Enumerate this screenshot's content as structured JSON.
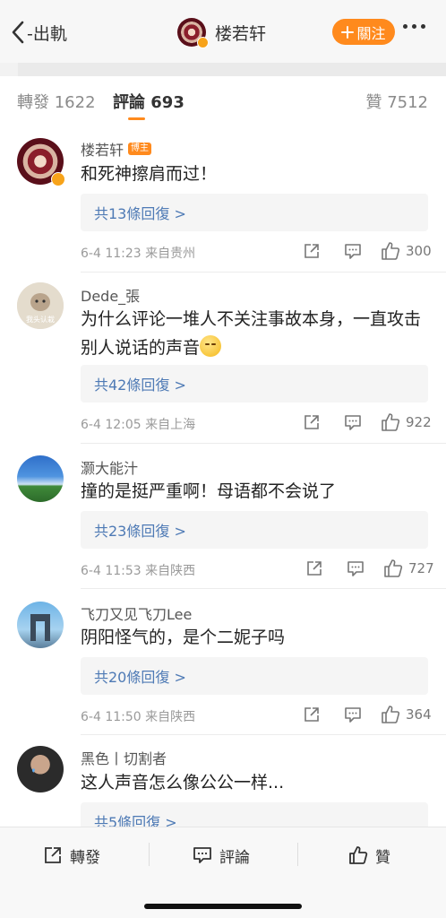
{
  "nav": {
    "back_label": "-出軌",
    "author_name": "楼若轩",
    "follow_label": "關注"
  },
  "tabs": {
    "repost": "轉發 1622",
    "comments": "評論 693",
    "likes": "贊 7512"
  },
  "comments": [
    {
      "author": "楼若轩",
      "author_tag": "博主",
      "text": "和死神擦肩而过！",
      "replies": "共13條回復 >",
      "meta": "6-4 11:23  来自贵州",
      "likes": "300"
    },
    {
      "author": "Dede_張",
      "avatar_text": "我头认栽",
      "text": "为什么评论一堆人不关注事故本身，一直攻击别人说话的声音",
      "emoji": "sleepy-emoji",
      "replies": "共42條回復 >",
      "meta": "6-4 12:05  来自上海",
      "likes": "922"
    },
    {
      "author": "灏大能汁",
      "text": "撞的是挺严重啊！母语都不会说了",
      "replies": "共23條回復 >",
      "meta": "6-4 11:53  来自陕西",
      "likes": "727"
    },
    {
      "author": "飞刀又见飞刀Lee",
      "text": "阴阳怪气的，是个二妮子吗",
      "replies": "共20條回復 >",
      "meta": "6-4 11:50  来自陕西",
      "likes": "364"
    },
    {
      "author": "黑色丨切割者",
      "text": "这人声音怎么像公公一样...",
      "replies": "共5條回復 >"
    }
  ],
  "bottom_bar": {
    "repost": "轉發",
    "comment": "評論",
    "like": "贊"
  },
  "colors": {
    "accent": "#ff8a1d",
    "link": "#4e7ab5",
    "verified_badge": "#f7a31a"
  }
}
